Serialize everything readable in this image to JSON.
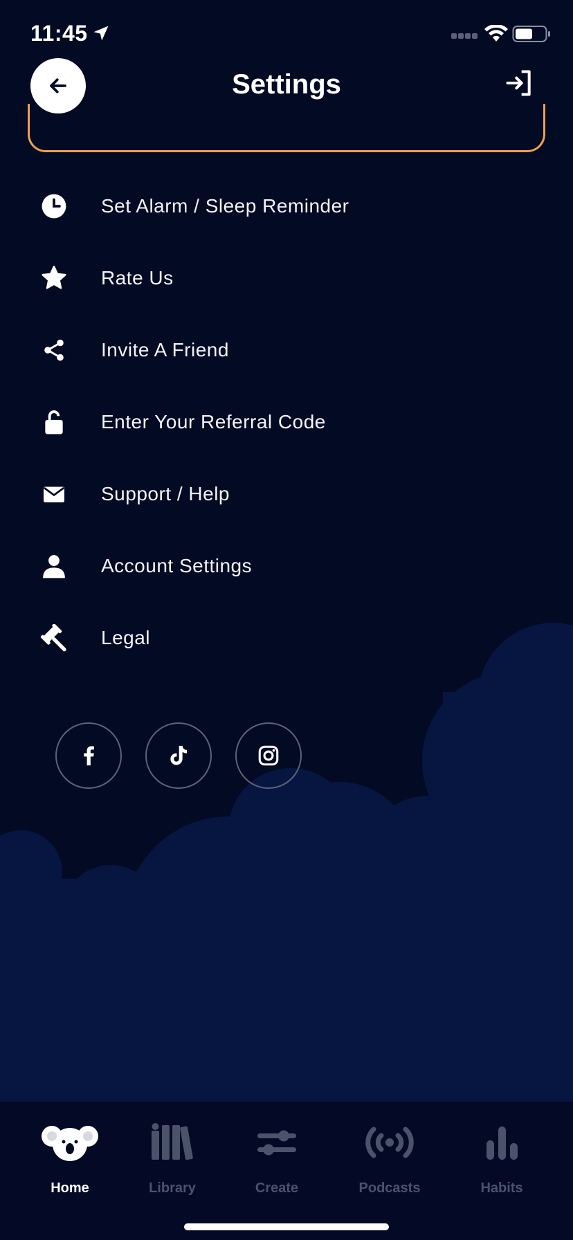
{
  "status_bar": {
    "time": "11:45"
  },
  "header": {
    "title": "Settings"
  },
  "menu": [
    {
      "label": "Set Alarm / Sleep Reminder",
      "icon": "clock-icon"
    },
    {
      "label": "Rate Us",
      "icon": "star-icon"
    },
    {
      "label": "Invite A Friend",
      "icon": "share-icon"
    },
    {
      "label": "Enter Your Referral Code",
      "icon": "unlock-icon"
    },
    {
      "label": "Support / Help",
      "icon": "envelope-icon"
    },
    {
      "label": "Account Settings",
      "icon": "user-icon"
    },
    {
      "label": "Legal",
      "icon": "gavel-icon"
    }
  ],
  "social": [
    "facebook-icon",
    "tiktok-icon",
    "instagram-icon"
  ],
  "tabs": [
    {
      "label": "Home",
      "icon": "koala-icon",
      "active": true
    },
    {
      "label": "Library",
      "icon": "books-icon",
      "active": false
    },
    {
      "label": "Create",
      "icon": "sliders-icon",
      "active": false
    },
    {
      "label": "Podcasts",
      "icon": "broadcast-icon",
      "active": false
    },
    {
      "label": "Habits",
      "icon": "bar-chart-icon",
      "active": false
    }
  ],
  "colors": {
    "background": "#030a24",
    "cloud": "#071640",
    "accent_border": "#f0a050",
    "tab_inactive": "#4a536a"
  }
}
